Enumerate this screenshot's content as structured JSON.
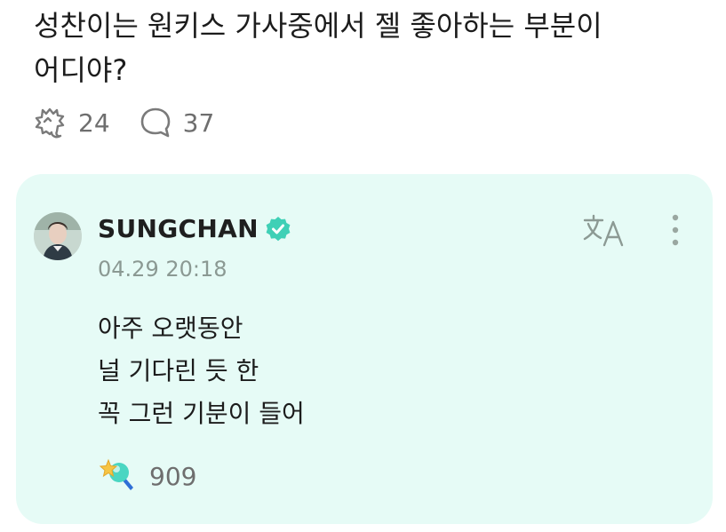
{
  "post": {
    "text": "성찬이는 원키스 가사중에서 젤 좋아하는 부분이 어디야?",
    "like_count": "24",
    "comment_count": "37"
  },
  "reply": {
    "author": "SUNGCHAN",
    "timestamp": "04.29 20:18",
    "lines": [
      "아주 오랫동안",
      "널 기다린 듯 한",
      "꼭 그런 기분이 들어"
    ],
    "reaction_count": "909"
  },
  "colors": {
    "card_background": "#e6fbf6",
    "accent": "#3fd0b6",
    "muted_text": "#6e6e6e",
    "timestamp_text": "#8b9993"
  },
  "icons": {
    "like": "bubble-heart-icon",
    "comment": "speech-bubble-icon",
    "verified": "verified-badge-icon",
    "translate": "translate-icon",
    "more": "more-vertical-icon",
    "reaction": "star-lightstick-icon"
  }
}
